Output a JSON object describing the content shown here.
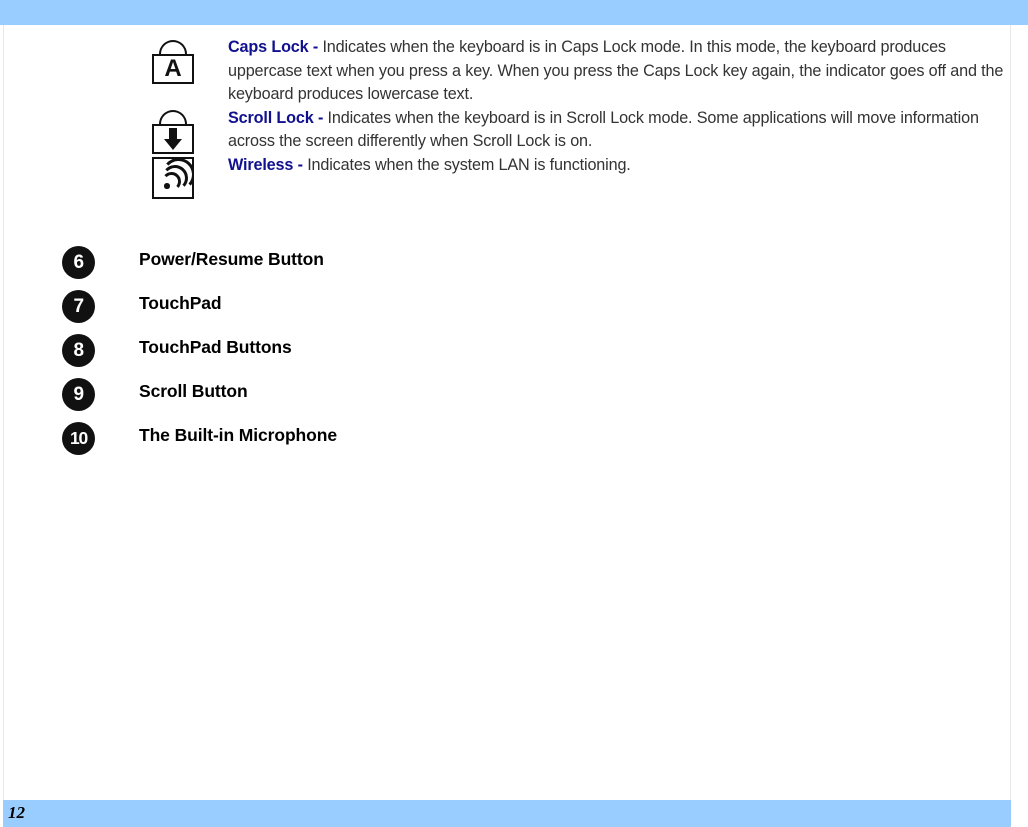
{
  "page": {
    "number": "12",
    "header_color": "#99ccff",
    "footer_color": "#99ccff",
    "term_color": "#11118f",
    "body_text_color": "#333333"
  },
  "indicators": [
    {
      "icon": "caps-lock-padlock-a-icon",
      "icon_letter": "A",
      "term": "Caps Lock - ",
      "description": "Indicates when the keyboard is in Caps Lock mode.  In this mode, the keyboard produces uppercase text when you press a key.  When you press the Caps Lock key again, the indicator goes off and the keyboard produces lowercase text."
    },
    {
      "icon": "scroll-lock-padlock-arrow-icon",
      "term": "Scroll Lock - ",
      "description": "Indicates when the keyboard is in Scroll Lock mode.  Some applications will move information across the screen differently when Scroll Lock is on."
    },
    {
      "icon": "wireless-signal-icon",
      "term": "Wireless - ",
      "description": "Indicates when the system LAN is functioning."
    }
  ],
  "numbered_items": [
    {
      "number": "6",
      "label": "Power/Resume Button"
    },
    {
      "number": "7",
      "label": "TouchPad"
    },
    {
      "number": "8",
      "label": "TouchPad Buttons"
    },
    {
      "number": "9",
      "label": "Scroll Button"
    },
    {
      "number": "10",
      "label": "The Built-in Microphone"
    }
  ]
}
